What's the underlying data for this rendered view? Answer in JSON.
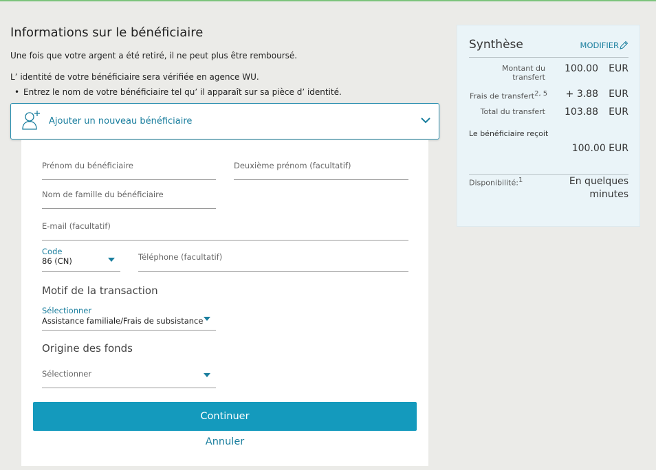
{
  "header": {
    "title": "Informations sur le bénéficiaire",
    "warning": "Une fois que votre argent a été retiré, il ne peut plus être remboursé.",
    "verify_note": "L’ identité de votre bénéficiaire sera vérifiée en agence WU.",
    "bullet": "Entrez le nom de votre bénéficiaire tel qu’ il apparaît sur sa pièce d’ identité."
  },
  "add_beneficiary": {
    "label": "Ajouter un nouveau bénéficiaire"
  },
  "form": {
    "first_name": {
      "placeholder": "Prénom du bénéficiaire",
      "value": ""
    },
    "middle_name": {
      "placeholder": "Deuxième prénom (facultatif)",
      "value": ""
    },
    "last_name": {
      "placeholder": "Nom de famille du bénéficiaire",
      "value": ""
    },
    "email": {
      "placeholder": "E-mail (facultatif)",
      "value": ""
    },
    "country_code": {
      "label": "Code",
      "value": "86 (CN)"
    },
    "phone": {
      "placeholder": "Téléphone (facultatif)",
      "value": ""
    },
    "reason": {
      "section_title": "Motif de la transaction",
      "label": "Sélectionner",
      "value": "Assistance familiale/Frais de subsistance"
    },
    "funds_origin": {
      "section_title": "Origine des fonds",
      "placeholder": "Sélectionner"
    },
    "continue_label": "Continuer",
    "cancel_label": "Annuler"
  },
  "summary": {
    "title": "Synthèse",
    "modify_label": "MODIFIER",
    "rows": {
      "amount": {
        "label": "Montant du transfert",
        "amount": "100.00",
        "currency": "EUR"
      },
      "fees": {
        "label": "Frais de transfert",
        "sup": "2, 5",
        "amount": "+ 3.88",
        "currency": "EUR"
      },
      "total": {
        "label": "Total du transfert",
        "amount": "103.88",
        "currency": "EUR"
      }
    },
    "receives_label": "Le bénéficiaire reçoit",
    "receives_amount": "100.00 EUR",
    "availability_label": "Disponibilité:",
    "availability_sup": "1",
    "availability_value": "En quelques minutes"
  },
  "colors": {
    "accent": "#149abd",
    "link": "#1a7e9e",
    "summary_bg": "#eaf4f8",
    "page_bg": "#ebebe8"
  }
}
